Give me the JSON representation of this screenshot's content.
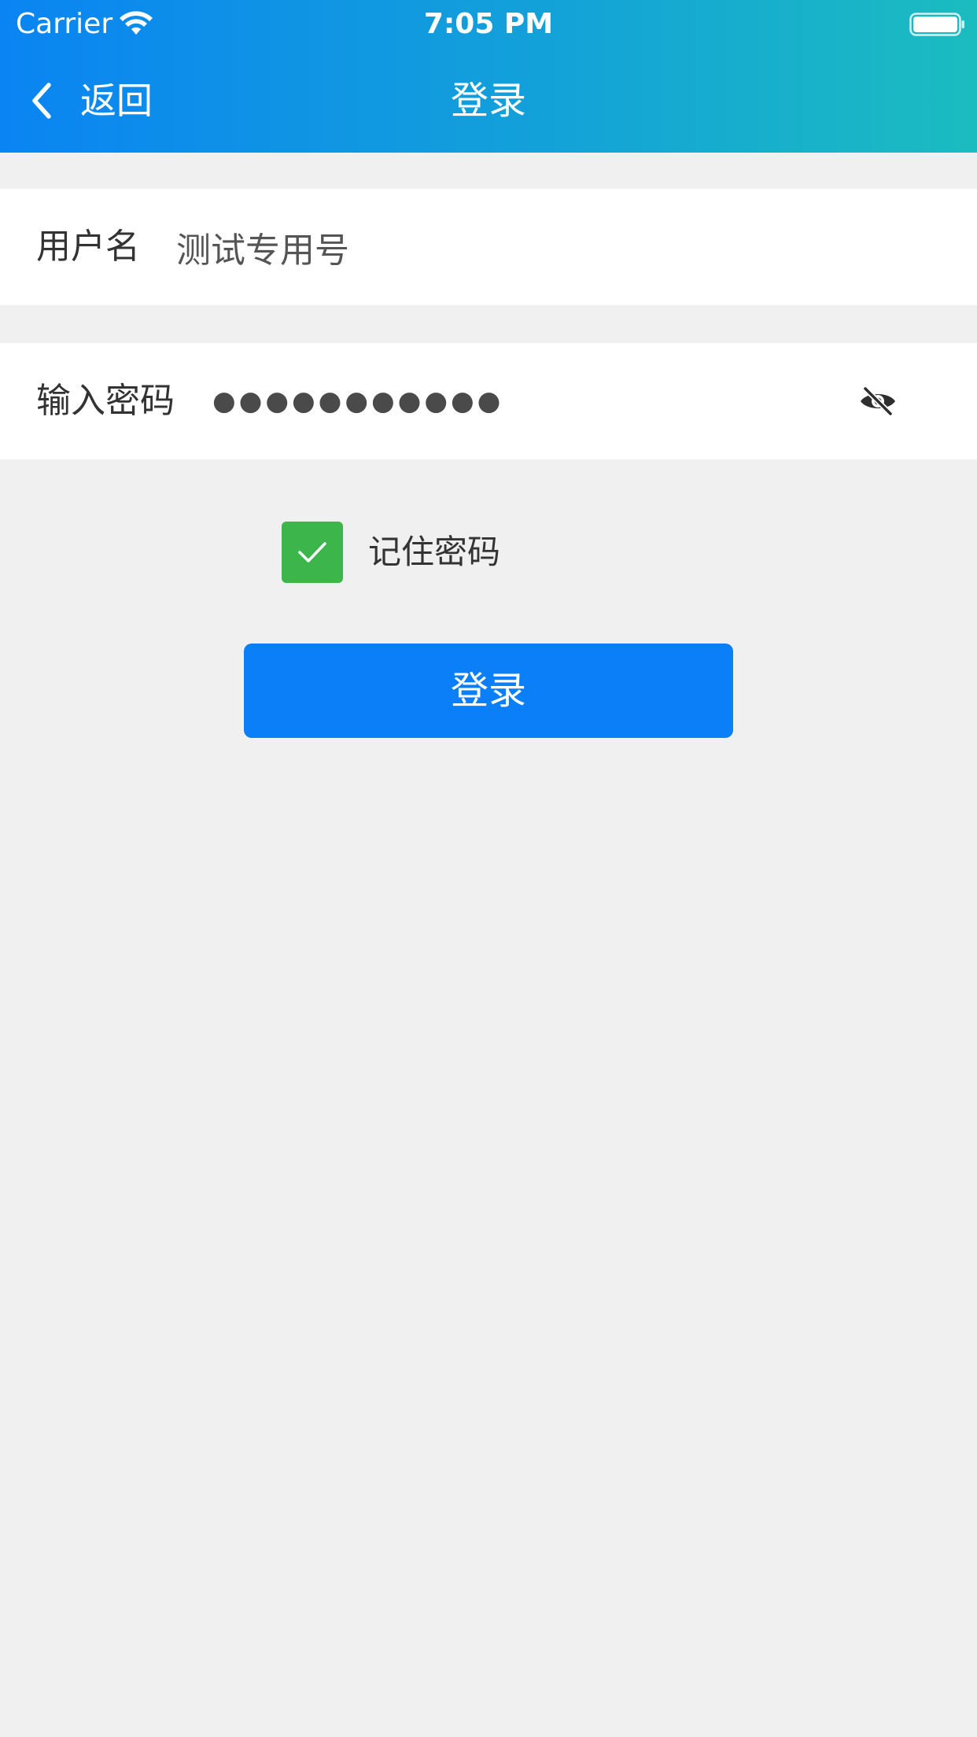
{
  "status_bar": {
    "carrier": "Carrier",
    "time": "7:05 PM",
    "wifi_icon": "wifi-icon",
    "battery_icon": "battery-icon"
  },
  "nav": {
    "back_label": "返回",
    "back_icon": "chevron-left-icon",
    "title": "登录"
  },
  "form": {
    "username": {
      "label": "用户名",
      "value": "测试专用号"
    },
    "password": {
      "label": "输入密码",
      "masked_value": "●●●●●●●●●●●",
      "toggle_icon": "eye-slash-icon"
    },
    "remember": {
      "label": "记住密码",
      "checked": true
    },
    "login_button_label": "登录"
  },
  "colors": {
    "header_gradient_start": "#0a84f2",
    "header_gradient_end": "#1bbcc0",
    "primary_button": "#0a7ff8",
    "checkbox_checked": "#3cb54a",
    "background": "#f0f0f0"
  }
}
